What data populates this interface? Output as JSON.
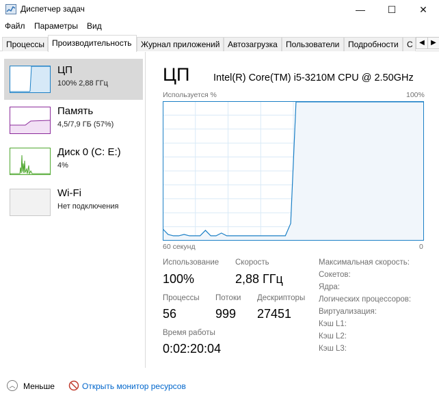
{
  "window": {
    "title": "Диспетчер задач",
    "buttons": {
      "minimize": "—",
      "maximize": "☐",
      "close": "✕"
    }
  },
  "menu": [
    "Файл",
    "Параметры",
    "Вид"
  ],
  "tabs": [
    "Процессы",
    "Производительность",
    "Журнал приложений",
    "Автозагрузка",
    "Пользователи",
    "Подробности",
    "С"
  ],
  "active_tab": "Производительность",
  "sidebar": {
    "items": [
      {
        "title": "ЦП",
        "subtitle": "100% 2,88 ГГц",
        "color": "#1a7fc6",
        "icon": "cpu-graph-icon"
      },
      {
        "title": "Память",
        "subtitle": "4,5/7,9 ГБ (57%)",
        "color": "#8b2a9b",
        "icon": "memory-graph-icon"
      },
      {
        "title": "Диск 0 (C: E:)",
        "subtitle": "4%",
        "color": "#4ea72e",
        "icon": "disk-graph-icon"
      },
      {
        "title": "Wi-Fi",
        "subtitle": "Нет подключения",
        "color": "#a9a9a9",
        "icon": "wifi-graph-icon"
      }
    ]
  },
  "main": {
    "heading": "ЦП",
    "model": "Intel(R) Core(TM) i5-3210M CPU @ 2.50GHz",
    "graph": {
      "top_left": "Используется %",
      "top_right": "100%",
      "bottom_left": "60 секунд",
      "bottom_right": "0",
      "color": "#1a7fc6",
      "usage_percent": [
        8,
        4,
        3,
        3,
        4,
        3,
        3,
        3,
        7,
        3,
        3,
        5,
        3,
        3,
        3,
        3,
        3,
        3,
        3,
        3,
        3,
        3,
        3,
        3,
        12,
        100,
        100,
        100,
        100,
        100,
        100,
        100,
        100,
        100,
        100,
        100,
        100,
        100,
        100,
        100,
        100,
        100,
        100,
        100,
        100,
        100,
        100,
        100,
        100,
        100
      ]
    },
    "stats": {
      "usage_label": "Использование",
      "usage_value": "100%",
      "speed_label": "Скорость",
      "speed_value": "2,88 ГГц",
      "processes_label": "Процессы",
      "processes_value": "56",
      "threads_label": "Потоки",
      "threads_value": "999",
      "handles_label": "Дескрипторы",
      "handles_value": "27451",
      "uptime_label": "Время работы",
      "uptime_value": "0:02:20:04"
    },
    "details": [
      "Максимальная скорость:",
      "Сокетов:",
      "Ядра:",
      "Логических процессоров:",
      "Виртуализация:",
      "Кэш L1:",
      "Кэш L2:",
      "Кэш L3:"
    ]
  },
  "footer": {
    "less": "Меньше",
    "resource_monitor": "Открыть монитор ресурсов"
  }
}
